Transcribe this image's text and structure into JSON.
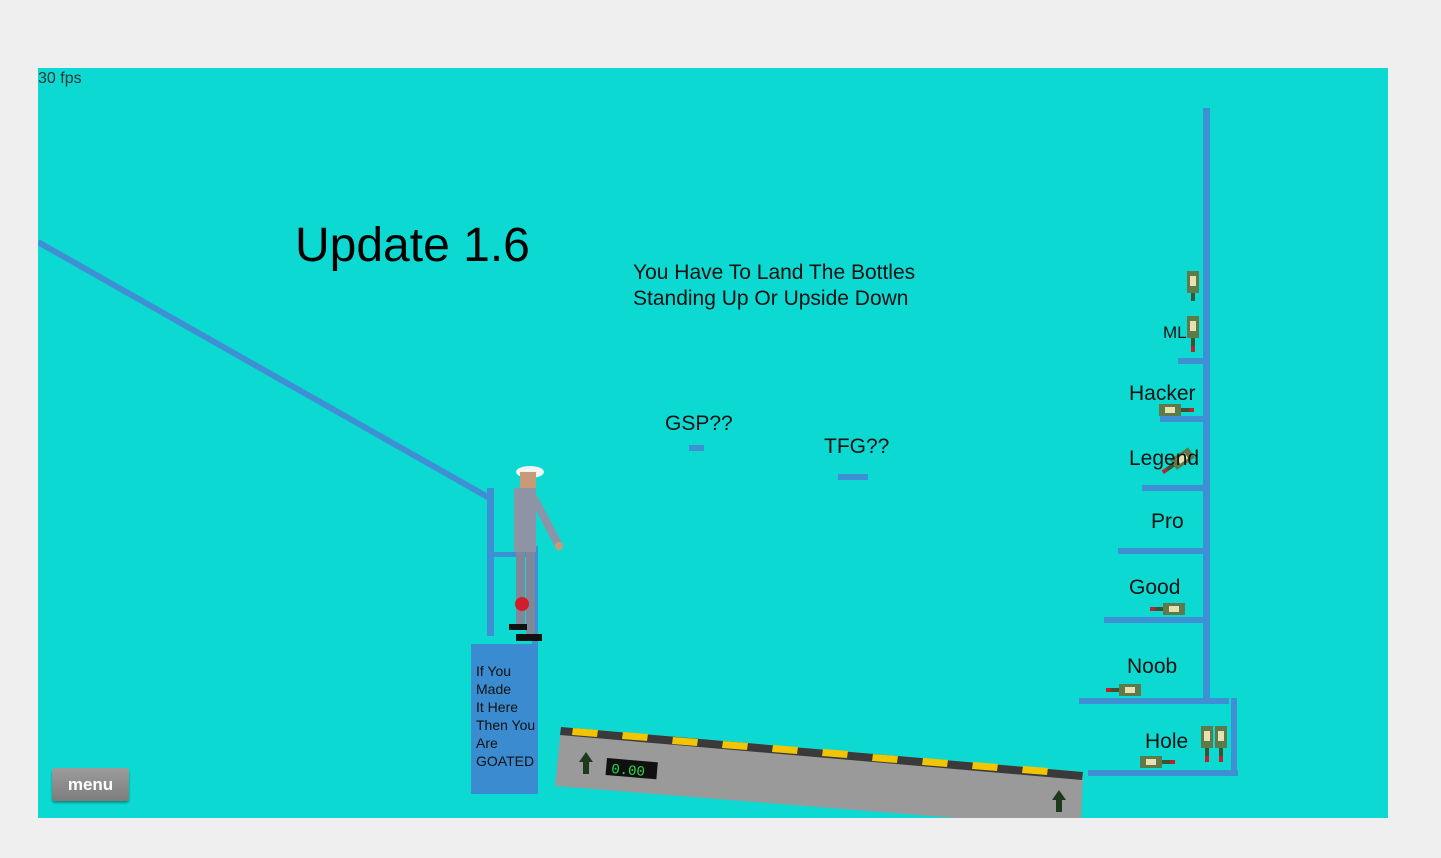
{
  "hud": {
    "fps": "30 fps"
  },
  "level": {
    "title": "Update 1.6",
    "instructions": [
      "You Have To Land The Bottles",
      "Standing Up Or Upside Down"
    ],
    "bonus_labels": {
      "gsp": "GSP??",
      "tfg": "TFG??"
    },
    "tiers": {
      "ml": "ML",
      "hacker": "Hacker",
      "legend": "Legend",
      "pro": "Pro",
      "good": "Good",
      "noob": "Noob",
      "hole": "Hole"
    },
    "goated_sign": [
      "If You",
      "Made",
      "It Here",
      "Then You",
      "Are",
      "GOATED"
    ],
    "speed_readout": "0.00"
  },
  "controls": {
    "menu_label": "menu"
  },
  "colors": {
    "background": "#0cdad2",
    "platform": "#3e8fd4",
    "page": "#efefef",
    "hazard_stripe": "#f2c500"
  }
}
